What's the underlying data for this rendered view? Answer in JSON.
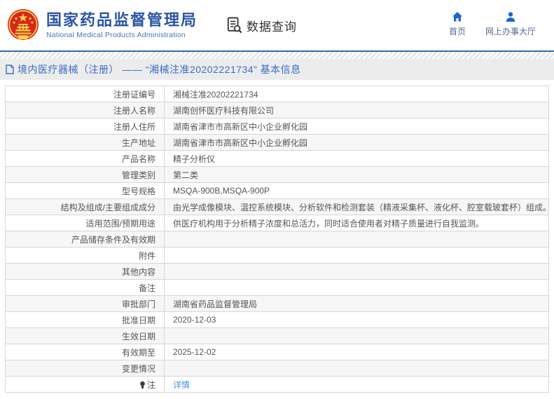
{
  "header": {
    "title": "国家药品监督管理局",
    "subtitle": "National Medical Products Administration",
    "section_label": "数据查询",
    "nav": [
      {
        "label": "首页",
        "icon": "home-icon"
      },
      {
        "label": "网上办事大厅",
        "icon": "person-icon"
      }
    ]
  },
  "breadcrumb": {
    "text": "境内医疗器械（注册） —— “湘械注准20202221734” 基本信息"
  },
  "colors": {
    "brand_blue": "#2b55a2",
    "line_blue": "#2f6db1",
    "breadcrumb_bg": "#ececec",
    "breadcrumb_text": "#3a6cc8",
    "link_blue": "#4193de",
    "emblem_red": "#d7261d",
    "emblem_gold": "#f9d44a",
    "alt_row_bg": "#f6f6f6"
  },
  "table": {
    "rows": [
      {
        "label": "注册证编号",
        "value": "湘械注准20202221734"
      },
      {
        "label": "注册人名称",
        "value": "湖南创怀医疗科技有限公司"
      },
      {
        "label": "注册人住所",
        "value": "湖南省津市市高新区中小企业孵化园"
      },
      {
        "label": "生产地址",
        "value": "湖南省津市市高新区中小企业孵化园"
      },
      {
        "label": "产品名称",
        "value": "精子分析仪"
      },
      {
        "label": "管理类别",
        "value": "第二类"
      },
      {
        "label": "型号规格",
        "value": "MSQA-900B,MSQA-900P"
      },
      {
        "label": "结构及组成/主要组成成分",
        "value": "由光学成像模块、温控系统模块、分析软件和检测套装（精液采集杯、液化杯、腔室载玻套杯）组成。"
      },
      {
        "label": "适用范围/预期用途",
        "value": "供医疗机构用于分析精子浓度和总活力，同时适合使用者对精子质量进行自我监测。"
      },
      {
        "label": "产品储存条件及有效期",
        "value": ""
      },
      {
        "label": "附件",
        "value": ""
      },
      {
        "label": "其他内容",
        "value": ""
      },
      {
        "label": "备注",
        "value": ""
      },
      {
        "label": "审批部门",
        "value": "湖南省药品监督管理局"
      },
      {
        "label": "批准日期",
        "value": "2020-12-03"
      },
      {
        "label": "生效日期",
        "value": ""
      },
      {
        "label": "有效期至",
        "value": "2025-12-02"
      },
      {
        "label": "变更情况",
        "value": ""
      },
      {
        "label": "注",
        "value": "详情",
        "is_link": true,
        "has_icon": true
      }
    ]
  }
}
